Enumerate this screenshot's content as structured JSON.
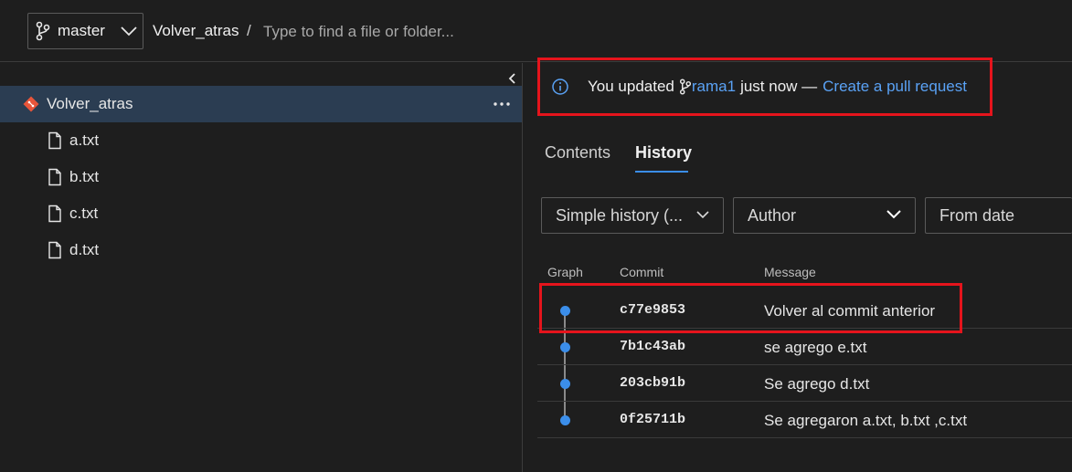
{
  "header": {
    "branch": "master",
    "repo": "Volver_atras",
    "separator": "/",
    "search_placeholder": "Type to find a file or folder..."
  },
  "tree": {
    "root": "Volver_atras",
    "files": [
      "a.txt",
      "b.txt",
      "c.txt",
      "d.txt"
    ]
  },
  "banner": {
    "prefix": "You updated",
    "branch": "rama1",
    "middle": "just now —",
    "link": "Create a pull request"
  },
  "tabs": {
    "contents": "Contents",
    "history": "History"
  },
  "filters": {
    "history_mode": "Simple history (...",
    "author": "Author",
    "from_date": "From date"
  },
  "columns": {
    "graph": "Graph",
    "commit": "Commit",
    "message": "Message"
  },
  "commits": [
    {
      "hash": "c77e9853",
      "message": "Volver al commit anterior"
    },
    {
      "hash": "7b1c43ab",
      "message": "se agrego e.txt"
    },
    {
      "hash": "203cb91b",
      "message": "Se agrego d.txt"
    },
    {
      "hash": "0f25711b",
      "message": "Se agregaron a.txt, b.txt ,c.txt"
    }
  ],
  "colors": {
    "accent": "#3b8eea",
    "highlight": "#e5141c",
    "selected_row": "#2b3d52",
    "git_icon": "#e8553a"
  }
}
